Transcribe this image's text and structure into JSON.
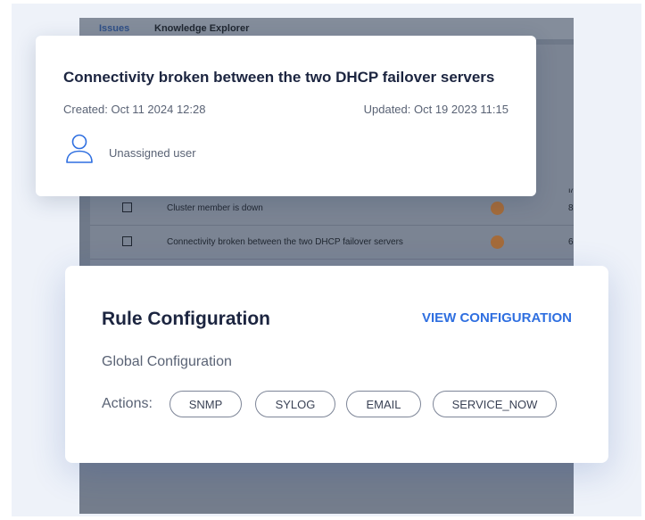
{
  "app": {
    "tabs": [
      {
        "label": "Issues"
      },
      {
        "label": "Knowledge Explorer"
      }
    ],
    "table": {
      "id_header": "I(",
      "rows": [
        {
          "title": "Cluster member is down",
          "id": "8"
        },
        {
          "title": "Connectivity broken between the two DHCP failover servers",
          "id": "6"
        }
      ]
    }
  },
  "issue_card": {
    "title": "Connectivity broken between the two DHCP failover servers",
    "created": "Created: Oct 11 2024 12:28",
    "updated": "Updated: Oct 19 2023 11:15",
    "assignee": "Unassigned user",
    "icon": "user-icon"
  },
  "rule_card": {
    "title": "Rule Configuration",
    "view_link": "VIEW CONFIGURATION",
    "subtitle": "Global Configuration",
    "actions_label": "Actions:",
    "actions": [
      "SNMP",
      "SYLOG",
      "EMAIL",
      "SERVICE_NOW"
    ],
    "accent_color": "#2f6fe0"
  }
}
